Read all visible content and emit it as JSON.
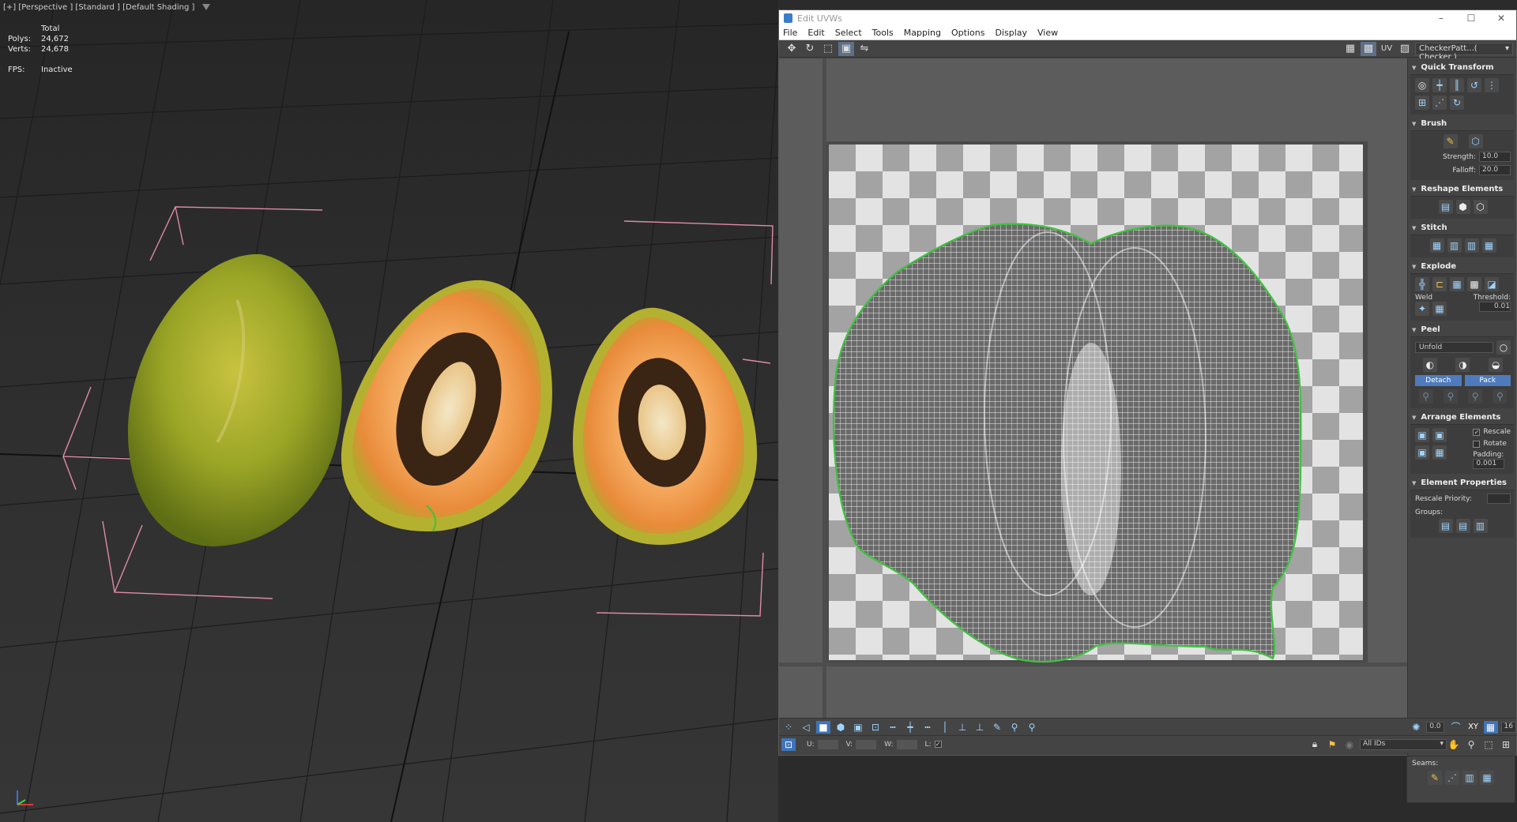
{
  "viewport": {
    "label": "[+] [Perspective ] [Standard ] [Default Shading ]",
    "stats": {
      "header": "Total",
      "polys_label": "Polys:",
      "polys_value": "24,672",
      "verts_label": "Verts:",
      "verts_value": "24,678",
      "fps_label": "FPS:",
      "fps_value": "Inactive"
    }
  },
  "uv_window": {
    "title": "Edit UVWs",
    "window_controls": [
      "–",
      "☐",
      "✕"
    ],
    "menu": [
      "File",
      "Edit",
      "Select",
      "Tools",
      "Mapping",
      "Options",
      "Display",
      "View"
    ],
    "toolbar": {
      "uv_label": "UV",
      "checker_dropdown": "CheckerPatt...( Checker )"
    },
    "panel": {
      "quick_transform": "Quick Transform",
      "brush": {
        "title": "Brush",
        "strength_label": "Strength:",
        "strength_value": "10.0",
        "falloff_label": "Falloff:",
        "falloff_value": "20.0"
      },
      "reshape": "Reshape Elements",
      "stitch": "Stitch",
      "explode": {
        "title": "Explode",
        "weld_label": "Weld",
        "threshold_label": "Threshold:",
        "threshold_value": "0.01"
      },
      "peel": {
        "title": "Peel",
        "mode": "Unfold",
        "detach": "Detach",
        "pack": "Pack"
      },
      "arrange": {
        "title": "Arrange Elements",
        "rescale": "Rescale",
        "rotate": "Rotate",
        "padding_label": "Padding:",
        "padding_value": "0.001"
      },
      "element_props": {
        "title": "Element Properties",
        "rescale_priority": "Rescale Priority:",
        "groups": "Groups:"
      }
    },
    "bottom": {
      "angle_value": "0.0",
      "xy_label": "XY",
      "grid_value": "16",
      "u_label": "U:",
      "v_label": "V:",
      "w_label": "W:",
      "l_label": "L:",
      "ids_dropdown": "All IDs"
    },
    "seams_label": "Seams:"
  },
  "colors": {
    "selection_green": "#3fc23f",
    "bracket_pink": "#e08aa8",
    "accent_blue": "#4e7bbd"
  }
}
